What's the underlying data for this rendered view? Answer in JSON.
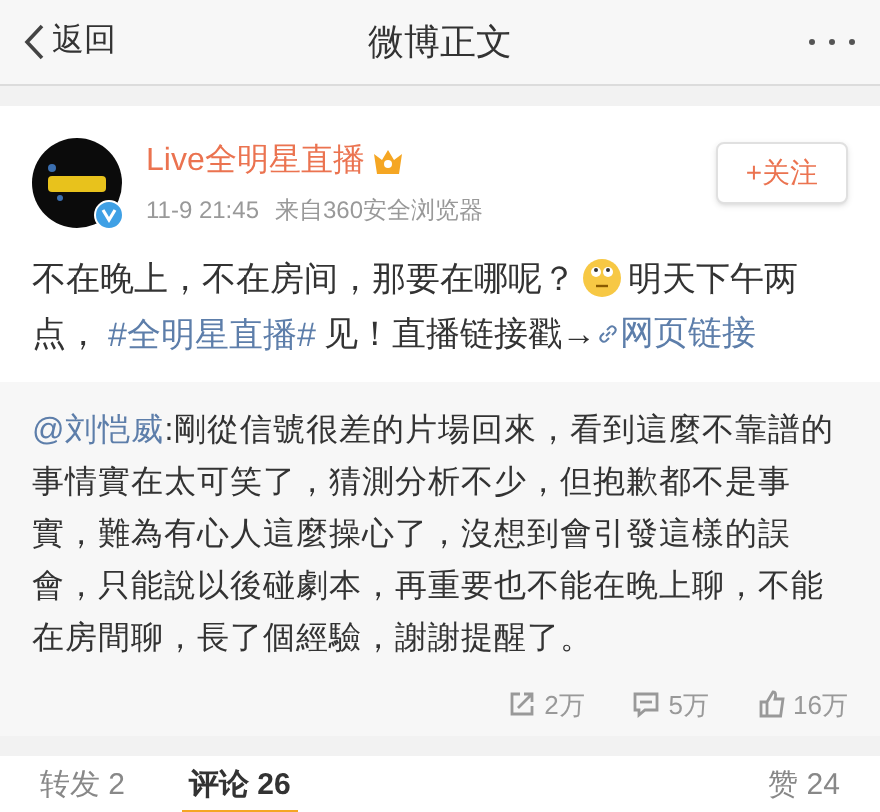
{
  "nav": {
    "back": "返回",
    "title": "微博正文"
  },
  "post": {
    "author": "Live全明星直播",
    "verified": true,
    "time": "11-9 21:45",
    "source": "来自360安全浏览器",
    "follow": "+关注",
    "text_1": "不在晚上，不在房间，那要在哪呢？",
    "text_2": "明天下午两点，",
    "hashtag": "#全明星直播#",
    "text_3": "见！直播链接戳→",
    "link": "网页链接"
  },
  "repost": {
    "mention": "@刘恺威",
    "text": ":剛從信號很差的片場回來，看到這麼不靠譜的事情實在太可笑了，猜測分析不少，但抱歉都不是事實，難為有心人這麼操心了，沒想到會引發這樣的誤會，只能說以後碰劇本，再重要也不能在晚上聊，不能在房間聊，長了個經驗，謝謝提醒了。",
    "stats": [
      {
        "kind": "share",
        "count": "2万"
      },
      {
        "kind": "comment",
        "count": "5万"
      },
      {
        "kind": "like",
        "count": "16万"
      }
    ]
  },
  "tabs": [
    {
      "label": "转发 2",
      "selected": false
    },
    {
      "label": "评论 26",
      "selected": true
    },
    {
      "label": "赞 24",
      "selected": false
    }
  ]
}
